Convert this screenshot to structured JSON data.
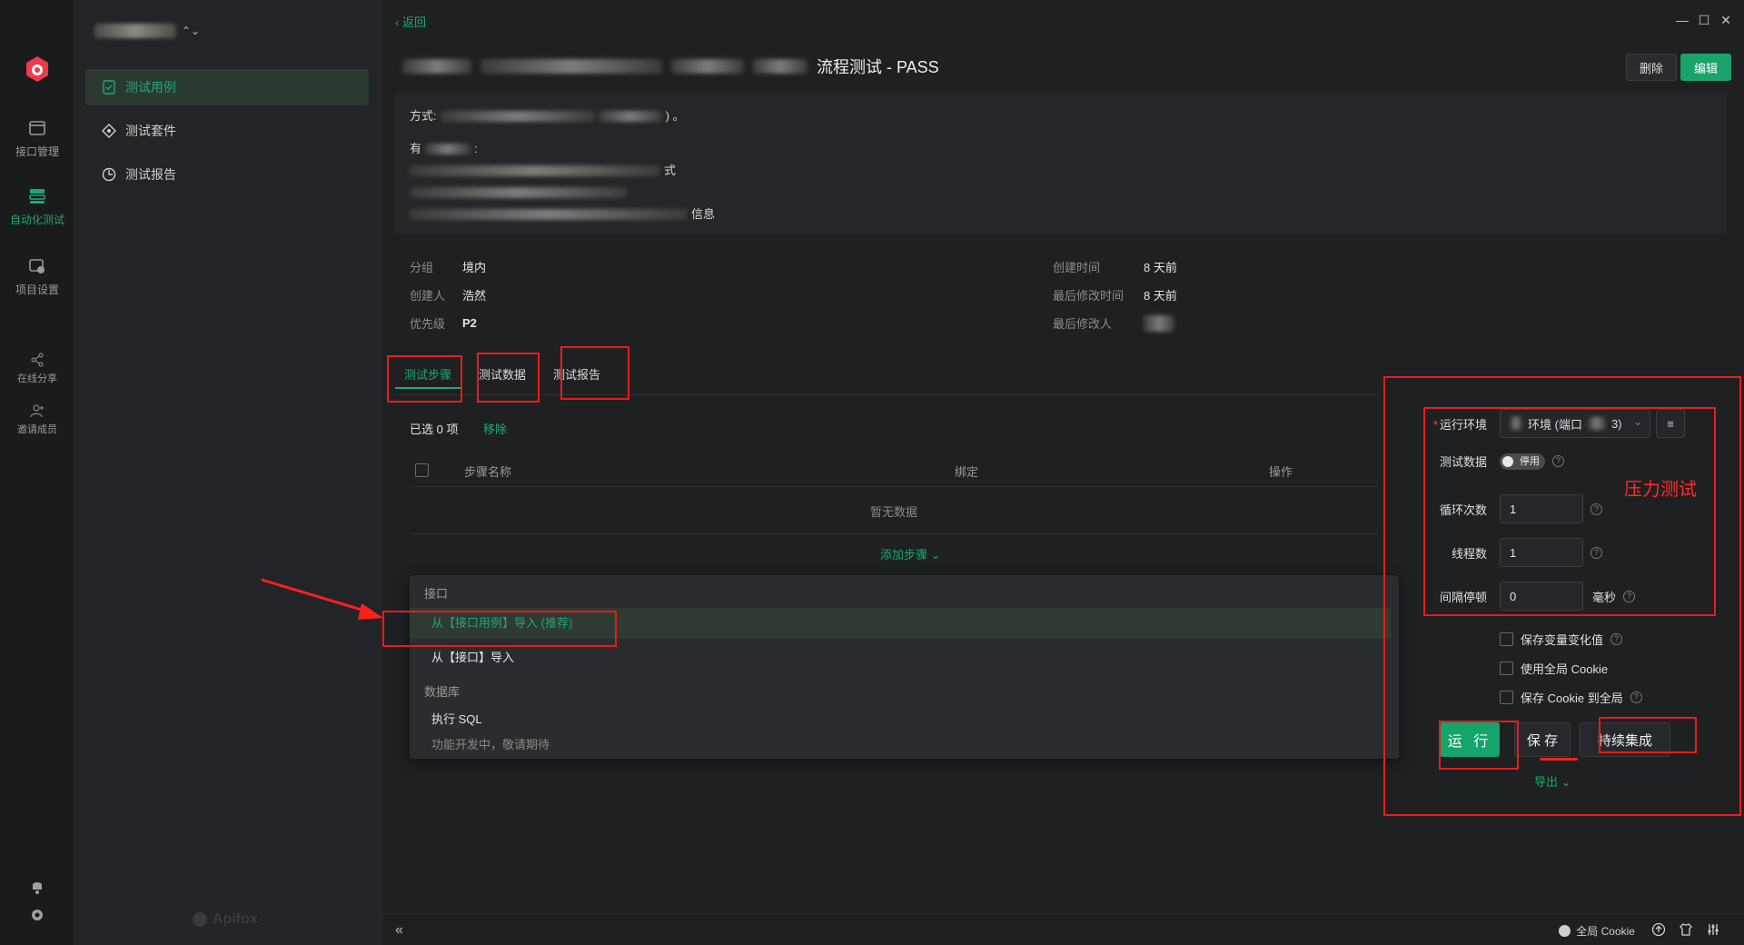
{
  "rail": {
    "items": [
      {
        "label": "接口管理",
        "icon": "api-icon"
      },
      {
        "label": "自动化测试",
        "icon": "automation-icon"
      },
      {
        "label": "项目设置",
        "icon": "settings-icon"
      },
      {
        "label": "在线分享",
        "icon": "share-icon"
      },
      {
        "label": "邀请成员",
        "icon": "invite-icon"
      }
    ]
  },
  "sidebar": {
    "items": [
      {
        "label": "测试用例"
      },
      {
        "label": "测试套件"
      },
      {
        "label": "测试报告"
      }
    ],
    "brand": "Apifox"
  },
  "header": {
    "back": "‹ 返回",
    "title": "流程测试 - PASS",
    "delete": "删除",
    "edit": "编辑"
  },
  "description": {
    "line1_prefix": "方式:",
    "line1_suffix": ") 。",
    "line2_prefix": "有",
    "line2_suffix": ":",
    "line3_suffix": "式",
    "line5_suffix": "信息"
  },
  "meta": {
    "left": [
      {
        "k": "分组",
        "v": "境内"
      },
      {
        "k": "创建人",
        "v": "浩然"
      },
      {
        "k": "优先级",
        "v": "P2"
      }
    ],
    "right": [
      {
        "k": "创建时间",
        "v": "8 天前"
      },
      {
        "k": "最后修改时间",
        "v": "8 天前"
      },
      {
        "k": "最后修改人",
        "v": ""
      }
    ]
  },
  "tabs": [
    {
      "label": "测试步骤"
    },
    {
      "label": "测试数据"
    },
    {
      "label": "测试报告"
    }
  ],
  "steps": {
    "selected": "已选 0 项",
    "remove": "移除",
    "columns": {
      "name": "步骤名称",
      "bind": "绑定",
      "action": "操作"
    },
    "empty": "暂无数据",
    "add": "添加步骤 ⌄"
  },
  "dropdown": {
    "group1": "接口",
    "item1": "从【接口用例】导入 (推荐)",
    "item2": "从【接口】导入",
    "group2": "数据库",
    "item3": "执行 SQL",
    "item3_sub": "功能开发中，敬请期待"
  },
  "run_panel": {
    "env_label": "运行环境",
    "env_value": "环境 (端口",
    "env_value_tail": "3)",
    "data_label": "测试数据",
    "data_toggle": "停用",
    "loop_label": "循环次数",
    "loop_value": "1",
    "thread_label": "线程数",
    "thread_value": "1",
    "interval_label": "间隔停顿",
    "interval_value": "0",
    "interval_unit": "毫秒",
    "opt1": "保存变量变化值",
    "opt2": "使用全局 Cookie",
    "opt3": "保存 Cookie 到全局",
    "run": "运 行",
    "save": "保 存",
    "ci": "持续集成",
    "export": "导出 ⌄"
  },
  "annotation": {
    "stress": "压力测试"
  },
  "bottombar": {
    "collapse": "«",
    "cookie": "全局 Cookie"
  },
  "colors": {
    "accent": "#1fa971",
    "annotation": "#e81c1c"
  }
}
